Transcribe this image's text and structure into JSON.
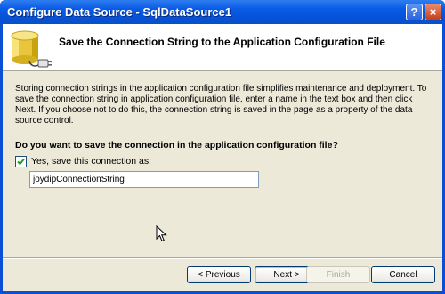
{
  "window": {
    "title": "Configure Data Source - SqlDataSource1",
    "help_label": "?",
    "close_label": "×"
  },
  "header": {
    "title": "Save the Connection String to the Application Configuration File",
    "icon": "database-plug-icon"
  },
  "content": {
    "description": "Storing connection strings in the application configuration file simplifies maintenance and deployment. To save the connection string in application configuration file, enter a name in the text box and then click Next. If you choose not to do this, the connection string is saved in the page as a property of the data source control.",
    "question": "Do you want to save the connection in the application configuration file?",
    "checkbox_label": "Yes, save this connection as:",
    "checkbox_checked": true,
    "connection_name": "joydipConnectionString"
  },
  "buttons": {
    "back": "< Previous",
    "next": "Next >",
    "finish": "Finish",
    "cancel": "Cancel"
  },
  "colors": {
    "titlebar": "#0a5ce6",
    "dialog_background": "#ece9d8",
    "button_border": "#003c74"
  }
}
